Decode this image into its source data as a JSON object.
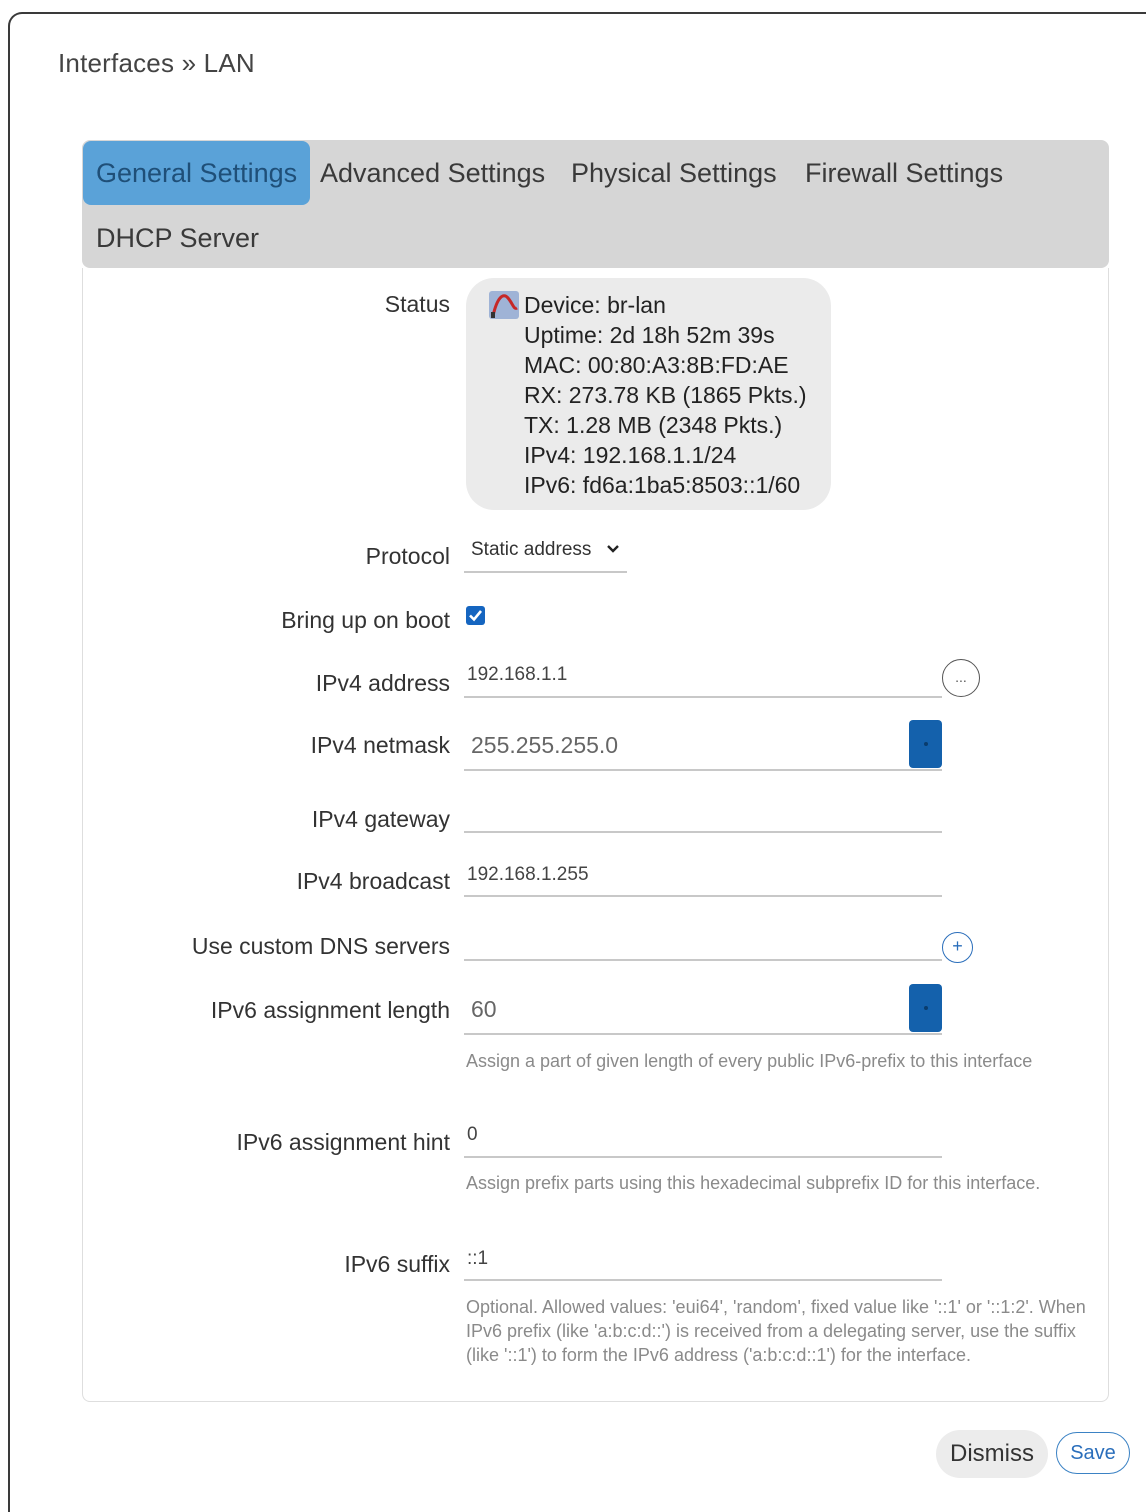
{
  "header": {
    "title": "Interfaces » LAN"
  },
  "tabs": [
    {
      "label": "General Settings",
      "active": true
    },
    {
      "label": "Advanced Settings",
      "active": false
    },
    {
      "label": "Physical Settings",
      "active": false
    },
    {
      "label": "Firewall Settings",
      "active": false
    },
    {
      "label": "DHCP Server",
      "active": false
    }
  ],
  "status": {
    "label": "Status",
    "lines": [
      "Device: br-lan",
      "Uptime: 2d 18h 52m 39s",
      "MAC: 00:80:A3:8B:FD:AE",
      "RX: 273.78 KB (1865 Pkts.)",
      "TX: 1.28 MB (2348 Pkts.)",
      "IPv4: 192.168.1.1/24",
      "IPv6: fd6a:1ba5:8503::1/60"
    ]
  },
  "fields": {
    "protocol": {
      "label": "Protocol",
      "value": "Static address"
    },
    "boot": {
      "label": "Bring up on boot",
      "checked": true
    },
    "ipv4_address": {
      "label": "IPv4 address",
      "value": "192.168.1.1",
      "button": "..."
    },
    "ipv4_netmask": {
      "label": "IPv4 netmask",
      "value": "255.255.255.0"
    },
    "ipv4_gateway": {
      "label": "IPv4 gateway",
      "value": ""
    },
    "ipv4_broadcast": {
      "label": "IPv4 broadcast",
      "value": "192.168.1.255"
    },
    "dns": {
      "label": "Use custom DNS servers",
      "value": "",
      "button": "+"
    },
    "ipv6_assign_len": {
      "label": "IPv6 assignment length",
      "value": "60",
      "help": "Assign a part of given length of every public IPv6-prefix to this interface"
    },
    "ipv6_assign_hint": {
      "label": "IPv6 assignment hint",
      "value": "0",
      "help": "Assign prefix parts using this hexadecimal subprefix ID for this interface."
    },
    "ipv6_suffix": {
      "label": "IPv6 suffix",
      "value": "::1",
      "help": "Optional. Allowed values: 'eui64', 'random', fixed value like '::1' or '::1:2'. When IPv6 prefix (like 'a:b:c:d::') is received from a delegating server, use the suffix (like '::1') to form the IPv6 address ('a:b:c:d::1') for the interface."
    }
  },
  "footer": {
    "dismiss": "Dismiss",
    "save": "Save"
  },
  "colors": {
    "accent": "#1461ac",
    "active_tab": "#5aa2d8",
    "tab_bar": "#d6d6d6"
  }
}
